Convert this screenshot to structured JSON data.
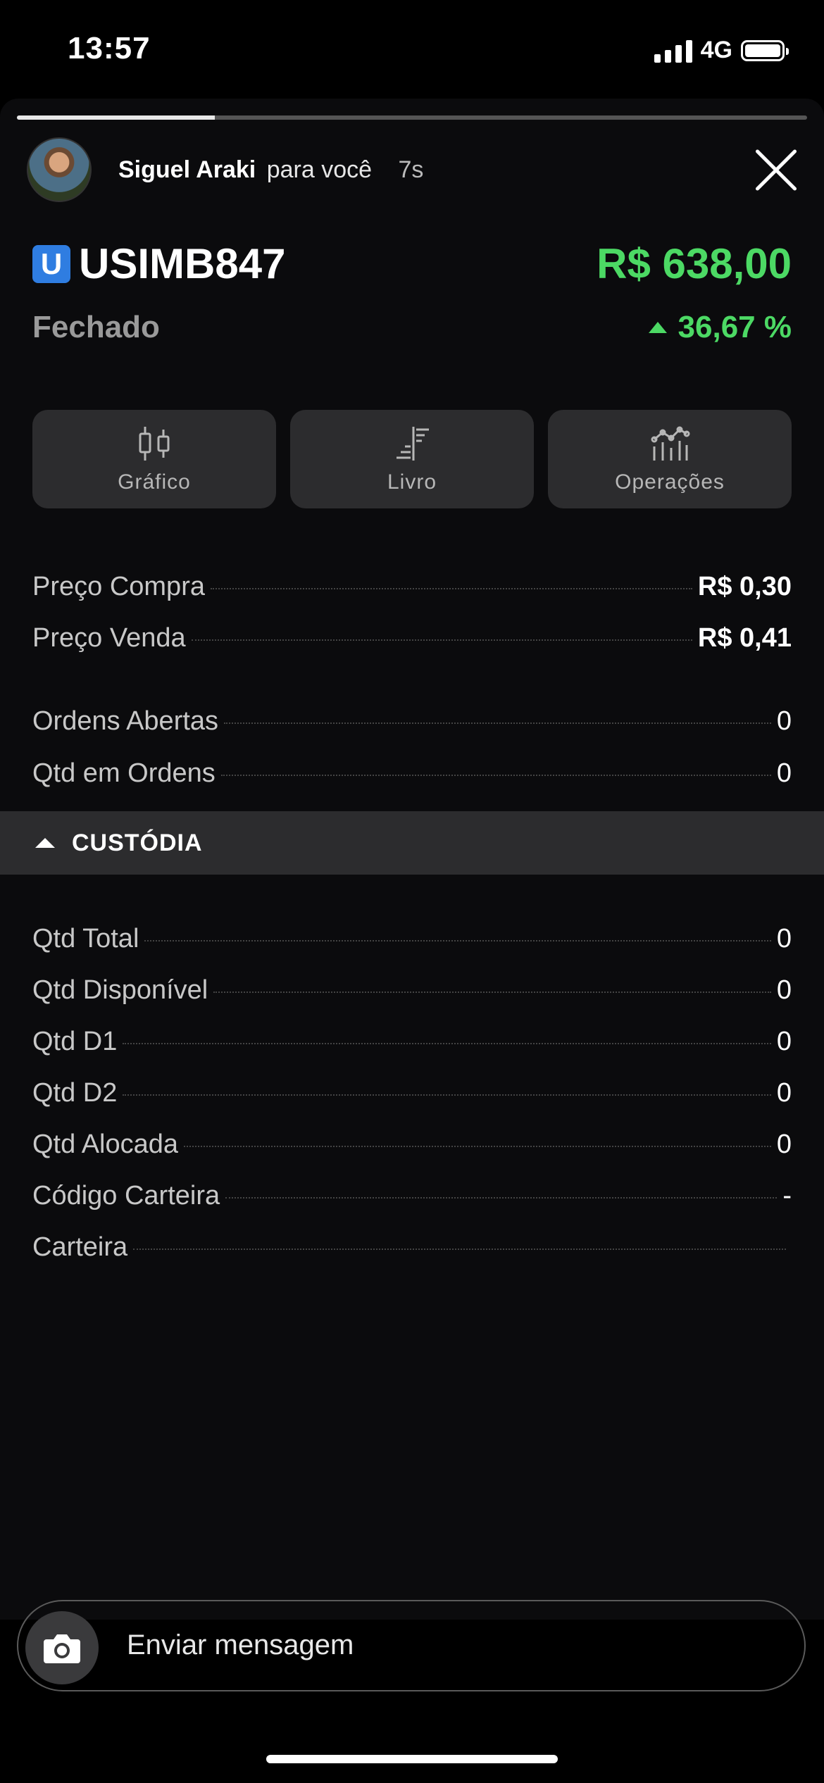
{
  "status_bar": {
    "time": "13:57",
    "network": "4G"
  },
  "story": {
    "user_name": "Siguel Araki",
    "subtitle": "para você",
    "age": "7s",
    "progress": 0.25
  },
  "asset": {
    "logo_letter": "U",
    "ticker": "USIMB847",
    "price": "R$ 638,00",
    "status": "Fechado",
    "change": "36,67 %",
    "accent_color": "#4cd964",
    "logo_color": "#2f7de1"
  },
  "actions": [
    {
      "label": "Gráfico",
      "icon": "candlestick-icon"
    },
    {
      "label": "Livro",
      "icon": "order-book-icon"
    },
    {
      "label": "Operações",
      "icon": "trades-chart-icon"
    }
  ],
  "quotes": [
    {
      "label": "Preço Compra",
      "value": "R$ 0,30"
    },
    {
      "label": "Preço Venda",
      "value": "R$ 0,41"
    }
  ],
  "orders": [
    {
      "label": "Ordens Abertas",
      "value": "0"
    },
    {
      "label": "Qtd em Ordens",
      "value": "0"
    }
  ],
  "custody": {
    "title": "CUSTÓDIA",
    "rows": [
      {
        "label": "Qtd Total",
        "value": "0"
      },
      {
        "label": "Qtd Disponível",
        "value": "0"
      },
      {
        "label": "Qtd D1",
        "value": "0"
      },
      {
        "label": "Qtd D2",
        "value": "0"
      },
      {
        "label": "Qtd Alocada",
        "value": "0"
      },
      {
        "label": "Código Carteira",
        "value": "-"
      },
      {
        "label": "Carteira",
        "value": ""
      }
    ]
  },
  "message": {
    "placeholder": "Enviar mensagem"
  }
}
